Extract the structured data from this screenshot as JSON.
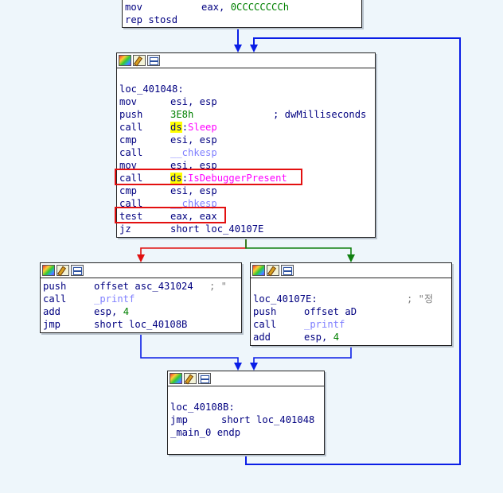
{
  "top_block": {
    "lines": [
      {
        "mnem": "mov",
        "op1": "eax, ",
        "op2": "0CCCCCCCCh"
      },
      {
        "mnem": "rep stosd",
        "op1": "",
        "op2": ""
      }
    ]
  },
  "main_block": {
    "label": "loc_401048:",
    "lines": [
      {
        "mnem": "mov",
        "ops": "esi, esp"
      },
      {
        "mnem": "push",
        "num": "3E8h",
        "comment": "; dwMilliseconds"
      },
      {
        "mnem": "call",
        "seg": "ds",
        "sep": ":",
        "target": "Sleep"
      },
      {
        "mnem": "cmp",
        "ops": "esi, esp"
      },
      {
        "mnem": "call",
        "target": "__chkesp"
      },
      {
        "mnem": "mov",
        "ops": "esi, esp"
      },
      {
        "mnem": "call",
        "seg": "ds",
        "sep": ":",
        "target": "IsDebuggerPresent"
      },
      {
        "mnem": "cmp",
        "ops": "esi, esp"
      },
      {
        "mnem": "call",
        "target": "__chkesp"
      },
      {
        "mnem": "test",
        "ops": "eax, eax"
      },
      {
        "mnem": "jz",
        "ops": "short loc_40107E"
      }
    ]
  },
  "left_block": {
    "lines": [
      {
        "mnem": "push",
        "ops": "offset asc_431024",
        "comment": "; \""
      },
      {
        "mnem": "call",
        "target": "_printf"
      },
      {
        "mnem": "add",
        "ops": "esp, ",
        "num": "4"
      },
      {
        "mnem": "jmp",
        "ops": "short loc_40108B"
      }
    ]
  },
  "right_block": {
    "label": "loc_40107E:",
    "label_comment": "; \"정",
    "lines": [
      {
        "mnem": "push",
        "ops": "offset aD"
      },
      {
        "mnem": "call",
        "target": "_printf"
      },
      {
        "mnem": "add",
        "ops": "esp, ",
        "num": "4"
      }
    ]
  },
  "bottom_block": {
    "label": "loc_40108B:",
    "lines": [
      {
        "mnem": "jmp",
        "ops": "short loc_401048"
      },
      {
        "mnem": "_main_0 endp",
        "ops": ""
      }
    ]
  },
  "header_icons": [
    "color-palette-icon",
    "edit-icon",
    "graph-icon"
  ],
  "colors": {
    "background": "#eef6fb",
    "edge_blue": "#0a1ee6",
    "edge_red": "#e01010",
    "edge_green": "#108010",
    "highlight_box": "#e31010",
    "imported_call": "#ff00ff",
    "library_call": "#8080ff",
    "number": "#008000",
    "code_text": "#000080"
  }
}
